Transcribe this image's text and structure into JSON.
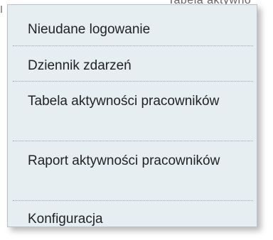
{
  "background": {
    "partial_text": "Tabela aktywno"
  },
  "menu": {
    "items": [
      {
        "label": "Nieudane logowanie"
      },
      {
        "label": "Dziennik zdarzeń"
      },
      {
        "label": "Tabela aktywności pracowników"
      },
      {
        "label": "Raport aktywności pracowników"
      },
      {
        "label": "Konfiguracja"
      }
    ]
  }
}
